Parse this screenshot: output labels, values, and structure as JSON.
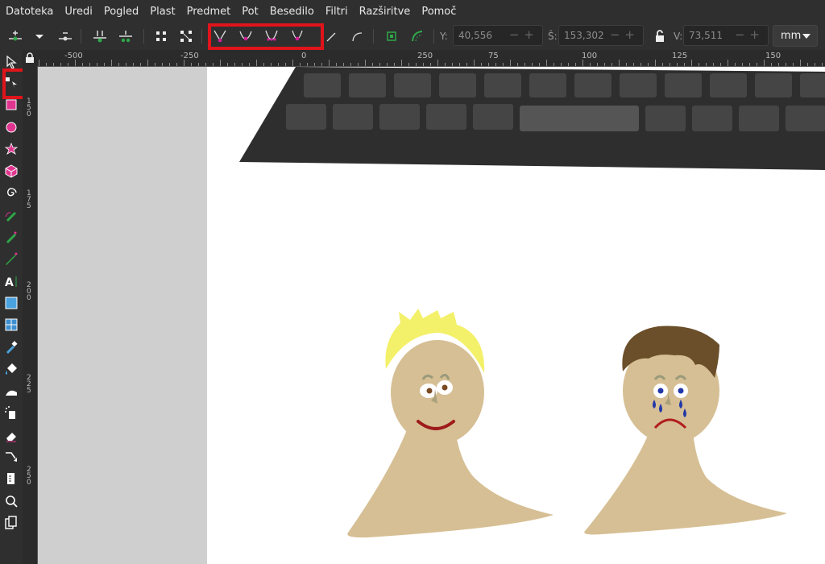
{
  "menu": [
    "Datoteka",
    "Uredi",
    "Pogled",
    "Plast",
    "Predmet",
    "Pot",
    "Besedilo",
    "Filtri",
    "Razširitve",
    "Pomoč"
  ],
  "coords": {
    "y_label": "Y:",
    "y_value": "40,556",
    "w_label": "Š:",
    "w_value": "153,302",
    "h_label": "V:",
    "h_value": "73,511",
    "unit": "mm"
  },
  "ruler_top": [
    "-500",
    "-250",
    "0",
    "250",
    "75",
    "100",
    "125",
    "150"
  ],
  "ruler_left": [
    "1\n5\n0",
    "1\n7\n5",
    "2\n0\n0",
    "2\n2\n5",
    "2\n5\n0"
  ],
  "colors": {
    "highlight": "#e0141b",
    "hair_yellow": "#f3f06a",
    "hair_brown": "#6b4f2a",
    "skin": "#d6bf94",
    "smile": "#9e1b1b",
    "tears": "#2338a8"
  },
  "icons": {
    "tools": [
      "selector",
      "node-editor",
      "rectangle",
      "ellipse",
      "star",
      "3d-box",
      "spiral",
      "pencil",
      "pen",
      "calligraphy",
      "text",
      "gradient",
      "mesh",
      "dropper",
      "paint-bucket",
      "tweak",
      "spray",
      "eraser",
      "connector",
      "measure",
      "zoom",
      "pages"
    ]
  }
}
